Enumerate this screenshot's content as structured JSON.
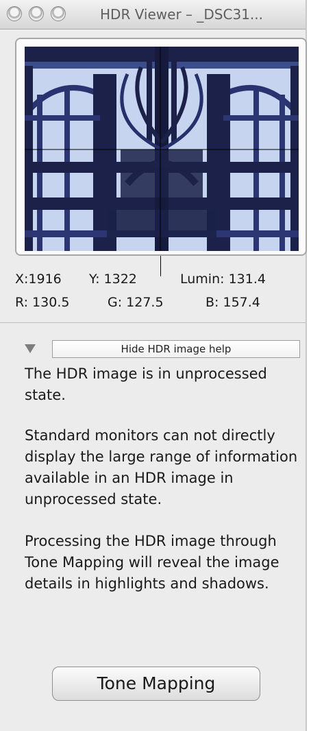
{
  "window": {
    "title": "HDR Viewer – _DSC31..."
  },
  "readout": {
    "x": "X:1916",
    "y": "Y: 1322",
    "lumin": "Lumin: 131.4",
    "r": "R: 130.5",
    "g": "G: 127.5",
    "b": "B: 157.4"
  },
  "help": {
    "toggle_label": "Hide HDR image help",
    "para1": "The HDR image is in unprocessed state.",
    "para2": "Standard monitors can not directly display the large range of information available in an HDR image in unprocessed state.",
    "para3": "Processing the HDR image through Tone Mapping will reveal the image details in highlights and shadows."
  },
  "actions": {
    "tone_mapping_label": "Tone Mapping"
  },
  "colors": {
    "image_dark": "#1b2148",
    "image_mid": "#3b4d8b",
    "image_light": "#c7d4ef"
  }
}
